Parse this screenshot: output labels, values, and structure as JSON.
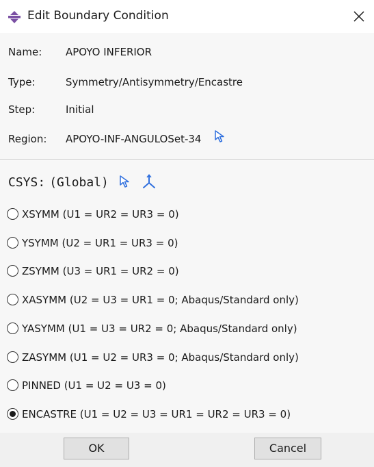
{
  "window": {
    "title": "Edit Boundary Condition",
    "title_icon": "boundary-condition-icon",
    "close_glyph": "✕"
  },
  "fields": [
    {
      "label": "Name:",
      "value": "APOYO INFERIOR"
    },
    {
      "label": "Type:",
      "value": "Symmetry/Antisymmetry/Encastre"
    },
    {
      "label": "Step:",
      "value": "Initial"
    },
    {
      "label": "Region:",
      "value": "APOYO-INF-ANGULOSet-34"
    }
  ],
  "csys": {
    "label": "CSYS:",
    "value": "(Global)"
  },
  "options": [
    {
      "label": "XSYMM (U1 = UR2 = UR3 = 0)",
      "checked": false
    },
    {
      "label": "YSYMM (U2 = UR1 = UR3 = 0)",
      "checked": false
    },
    {
      "label": "ZSYMM (U3 = UR1 = UR2 = 0)",
      "checked": false
    },
    {
      "label": "XASYMM (U2 = U3 = UR1 = 0; Abaqus/Standard only)",
      "checked": false
    },
    {
      "label": "YASYMM (U1 = U3 = UR2 = 0; Abaqus/Standard only)",
      "checked": false
    },
    {
      "label": "ZASYMM (U1 = U2 = UR3 = 0; Abaqus/Standard only)",
      "checked": false
    },
    {
      "label": "PINNED (U1 = U2 = U3 = 0)",
      "checked": false
    },
    {
      "label": "ENCASTRE (U1 = U2 = U3 = UR1 = UR2 = UR3 = 0)",
      "checked": true
    }
  ],
  "buttons": {
    "ok": "OK",
    "cancel": "Cancel"
  },
  "colors": {
    "accent": "#2f6fde",
    "title_icon": "#7a4fa3"
  }
}
